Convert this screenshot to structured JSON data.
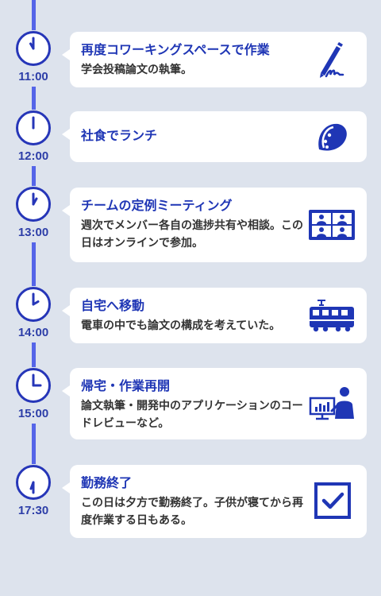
{
  "colors": {
    "background": "#dde3ed",
    "accent": "#5565e8",
    "title": "#1f36b5",
    "card": "#ffffff"
  },
  "timeline": [
    {
      "time": "11:00",
      "title": "再度コワーキングスペースで作業",
      "description": "学会投稿論文の執筆。",
      "icon": "pen-signature-icon"
    },
    {
      "time": "12:00",
      "title": "社食でランチ",
      "description": "",
      "icon": "taco-icon"
    },
    {
      "time": "13:00",
      "title": "チームの定例ミーティング",
      "description": "週次でメンバー各自の進捗共有や相談。この日はオンラインで参加。",
      "icon": "video-conference-icon"
    },
    {
      "time": "14:00",
      "title": "自宅へ移動",
      "description": "電車の中でも論文の構成を考えていた。",
      "icon": "train-icon"
    },
    {
      "time": "15:00",
      "title": "帰宅・作業再開",
      "description": "論文執筆・開発中のアプリケーションのコードレビューなど。",
      "icon": "presentation-user-icon"
    },
    {
      "time": "17:30",
      "title": "勤務終了",
      "description": "この日は夕方で勤務終了。子供が寝てから再度作業する日もある。",
      "icon": "checkbox-checked-icon"
    }
  ]
}
